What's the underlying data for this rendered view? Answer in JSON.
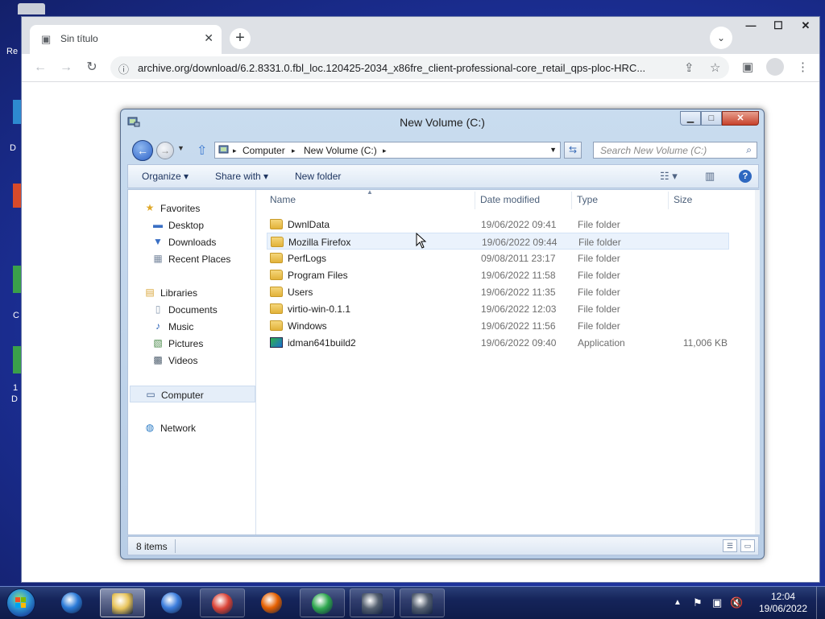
{
  "desktop": {
    "fragments": [
      "Re",
      "D",
      "C",
      "1",
      "D"
    ]
  },
  "chrome": {
    "tab": {
      "title": "Sin título",
      "close": "✕",
      "icon": "window-icon"
    },
    "new_tab": "+",
    "tab_search": "⌄",
    "window_controls": {
      "minimize": "—",
      "maximize": "☐",
      "close": "✕"
    },
    "nav": {
      "back": "←",
      "forward": "→",
      "reload": "↻"
    },
    "omnibox": {
      "url": "archive.org/download/6.2.8331.0.fbl_loc.120425-2034_x86fre_client-professional-core_retail_qps-ploc-HRC...",
      "info_icon": "ⓘ",
      "share_icon": "⇪",
      "star_icon": "☆"
    },
    "side_panel_icon": "▣",
    "menu_icon": "⋮"
  },
  "explorer": {
    "title": "New Volume (C:)",
    "controls": {
      "minimize": "▁",
      "maximize": "□",
      "close": "✕"
    },
    "address": {
      "crumbs": [
        "Computer",
        "New Volume (C:)"
      ],
      "separator": "▸"
    },
    "search_placeholder": "Search New Volume (C:)",
    "search_icon": "⌕",
    "commands": {
      "organize": "Organize ▾",
      "share_with": "Share with ▾",
      "new_folder": "New folder"
    },
    "help": "?",
    "nav_pane": [
      {
        "label": "Favorites",
        "icon": "★",
        "icon_name": "favorites-star-icon",
        "indent": 0,
        "color": "#e0a92a"
      },
      {
        "label": "Desktop",
        "icon": "▬",
        "icon_name": "desktop-icon",
        "indent": 1,
        "color": "#3a6fc4"
      },
      {
        "label": "Downloads",
        "icon": "▼",
        "icon_name": "downloads-icon",
        "indent": 1,
        "color": "#3a6fc4"
      },
      {
        "label": "Recent Places",
        "icon": "▦",
        "icon_name": "recent-places-icon",
        "indent": 1,
        "color": "#7a8aa0"
      },
      {
        "label": "Libraries",
        "icon": "▤",
        "icon_name": "libraries-icon",
        "indent": 0,
        "color": "#d9a73a"
      },
      {
        "label": "Documents",
        "icon": "▯",
        "icon_name": "documents-icon",
        "indent": 1,
        "color": "#8a9ab0"
      },
      {
        "label": "Music",
        "icon": "♪",
        "icon_name": "music-icon",
        "indent": 1,
        "color": "#2a63b8"
      },
      {
        "label": "Pictures",
        "icon": "▧",
        "icon_name": "pictures-icon",
        "indent": 1,
        "color": "#4a8a4a"
      },
      {
        "label": "Videos",
        "icon": "▩",
        "icon_name": "videos-icon",
        "indent": 1,
        "color": "#506070"
      },
      {
        "label": "Computer",
        "icon": "▭",
        "icon_name": "computer-icon",
        "indent": 0,
        "color": "#3a5a8a",
        "selected": true
      },
      {
        "label": "Network",
        "icon": "◍",
        "icon_name": "network-icon",
        "indent": 0,
        "color": "#2a7ac4"
      }
    ],
    "columns": {
      "name": "Name",
      "date": "Date modified",
      "type": "Type",
      "size": "Size"
    },
    "files": [
      {
        "name": "DwnlData",
        "date": "19/06/2022 09:41",
        "type": "File folder",
        "size": "",
        "kind": "folder"
      },
      {
        "name": "Mozilla Firefox",
        "date": "19/06/2022 09:44",
        "type": "File folder",
        "size": "",
        "kind": "folder",
        "hover": true
      },
      {
        "name": "PerfLogs",
        "date": "09/08/2011 23:17",
        "type": "File folder",
        "size": "",
        "kind": "folder"
      },
      {
        "name": "Program Files",
        "date": "19/06/2022 11:58",
        "type": "File folder",
        "size": "",
        "kind": "folder"
      },
      {
        "name": "Users",
        "date": "19/06/2022 11:35",
        "type": "File folder",
        "size": "",
        "kind": "folder"
      },
      {
        "name": "virtio-win-0.1.1",
        "date": "19/06/2022 12:03",
        "type": "File folder",
        "size": "",
        "kind": "folder"
      },
      {
        "name": "Windows",
        "date": "19/06/2022 11:56",
        "type": "File folder",
        "size": "",
        "kind": "folder"
      },
      {
        "name": "idman641build2",
        "date": "19/06/2022 09:40",
        "type": "Application",
        "size": "11,006 KB",
        "kind": "app"
      }
    ],
    "status": "8 items"
  },
  "taskbar": {
    "items": [
      {
        "name": "ie",
        "icon_name": "internet-explorer-icon",
        "state": "none",
        "color": "#2a7ad8"
      },
      {
        "name": "explorer",
        "icon_name": "file-explorer-icon",
        "state": "active",
        "color": "#e8c45a"
      },
      {
        "name": "thunderbird",
        "icon_name": "thunderbird-icon",
        "state": "none",
        "color": "#3b7ddd"
      },
      {
        "name": "chrome",
        "icon_name": "chrome-icon",
        "state": "pin",
        "color": "#db4437"
      },
      {
        "name": "firefox",
        "icon_name": "firefox-icon",
        "state": "none",
        "color": "#e66000"
      },
      {
        "name": "idm",
        "icon_name": "download-manager-icon",
        "state": "pin",
        "color": "#2fa84f"
      },
      {
        "name": "app1",
        "icon_name": "app-window-icon",
        "state": "pin",
        "color": "#556070"
      },
      {
        "name": "app2",
        "icon_name": "app-window-icon",
        "state": "pin",
        "color": "#556070"
      }
    ],
    "tray": {
      "arrow": "▲",
      "flag": "⚑",
      "network": "▣",
      "volume": "🔇"
    },
    "clock": {
      "time": "12:04",
      "date": "19/06/2022"
    }
  }
}
